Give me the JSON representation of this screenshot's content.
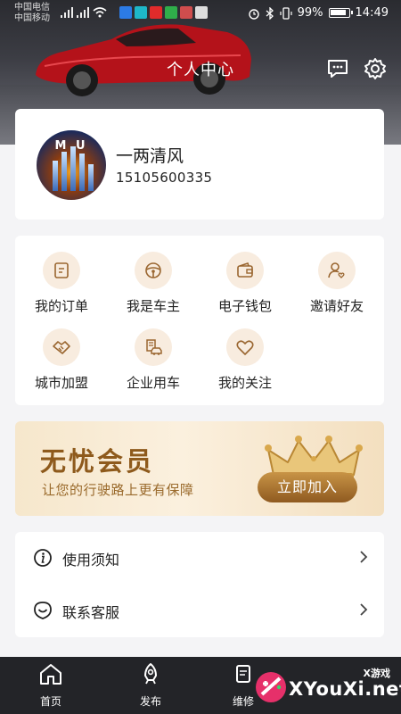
{
  "status_bar": {
    "carrier_line1": "中国电信",
    "carrier_line2": "中国移动",
    "battery": "99%",
    "time": "14:49"
  },
  "header": {
    "title": "个人中心",
    "icons": [
      "message-icon",
      "settings-icon"
    ]
  },
  "profile": {
    "avatar_text": "M U",
    "name": "一两清风",
    "phone": "15105600335"
  },
  "grid": {
    "items": [
      {
        "label": "我的订单",
        "icon": "order-icon"
      },
      {
        "label": "我是车主",
        "icon": "steering-wheel-icon"
      },
      {
        "label": "电子钱包",
        "icon": "wallet-icon"
      },
      {
        "label": "邀请好友",
        "icon": "invite-friend-icon"
      },
      {
        "label": "城市加盟",
        "icon": "handshake-icon"
      },
      {
        "label": "企业用车",
        "icon": "enterprise-car-icon"
      },
      {
        "label": "我的关注",
        "icon": "heart-icon"
      }
    ]
  },
  "vip": {
    "title": "无忧会员",
    "subtitle": "让您的行驶路上更有保障",
    "button": "立即加入"
  },
  "menu": {
    "items": [
      {
        "label": "使用须知",
        "icon": "info-icon"
      },
      {
        "label": "联系客服",
        "icon": "customer-service-icon"
      }
    ]
  },
  "bottom_nav": {
    "items": [
      {
        "label": "首页",
        "icon": "home-icon"
      },
      {
        "label": "发布",
        "icon": "publish-icon"
      },
      {
        "label": "维修",
        "icon": "repair-icon"
      }
    ]
  },
  "watermark": {
    "small": "X游戏",
    "big": "XYouXi.net"
  },
  "colors": {
    "accent_gold": "#8f5a20",
    "icon_bg": "#f8ecdf",
    "icon_stroke": "#9a6630",
    "nav_bg": "#232428"
  }
}
